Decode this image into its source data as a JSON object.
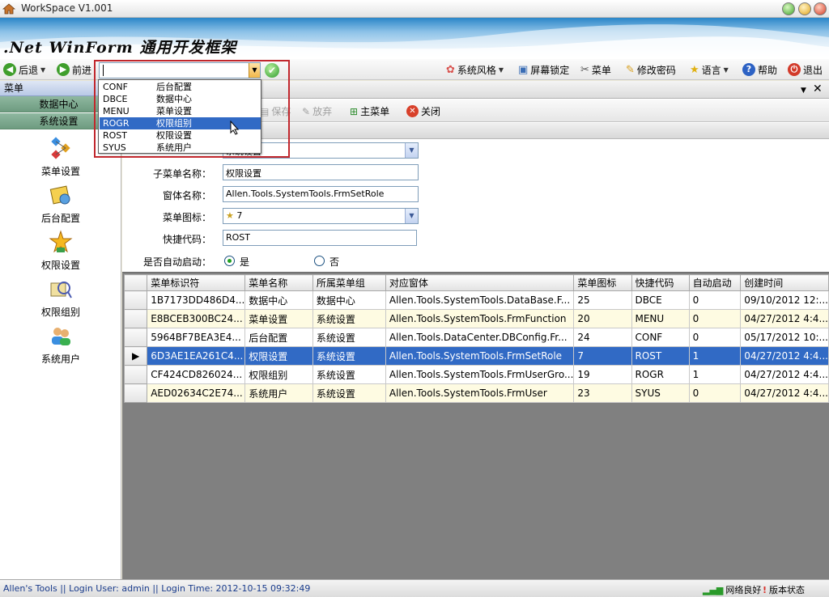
{
  "window": {
    "title": "WorkSpace  V1.001"
  },
  "banner": {
    "title": ".Net WinForm 通用开发框架"
  },
  "toolbar": {
    "back": "后退",
    "forward": "前进",
    "items": [
      "系统风格",
      "屏幕锁定",
      "菜单",
      "修改密码",
      "语言",
      "帮助",
      "退出"
    ]
  },
  "popup": {
    "rows": [
      {
        "code": "CONF",
        "name": "后台配置"
      },
      {
        "code": "DBCE",
        "name": "数据中心"
      },
      {
        "code": "MENU",
        "name": "菜单设置"
      },
      {
        "code": "ROGR",
        "name": "权限组别"
      },
      {
        "code": "ROST",
        "name": "权限设置"
      },
      {
        "code": "SYUS",
        "name": "系统用户"
      }
    ],
    "selected_index": 3
  },
  "leftnav": {
    "header": "菜单",
    "groups": [
      "数据中心",
      "系统设置"
    ],
    "items": [
      "菜单设置",
      "后台配置",
      "权限设置",
      "权限组别",
      "系统用户"
    ]
  },
  "formtoolbar": {
    "save": "保存",
    "discard": "放弃",
    "main_menu": "主菜单",
    "close": "关闭"
  },
  "form": {
    "group_value": "系统设置",
    "submenu_label": "子菜单名称：",
    "submenu_value": "权限设置",
    "window_label": "窗体名称：",
    "window_value": "Allen.Tools.SystemTools.FrmSetRole",
    "icon_label": "菜单图标：",
    "icon_value": "7",
    "shortcut_label": "快捷代码：",
    "shortcut_value": "ROST",
    "autostart_label": "是否自动启动：",
    "yes": "是",
    "no": "否"
  },
  "grid": {
    "columns": [
      "菜单标识符",
      "菜单名称",
      "所属菜单组",
      "对应窗体",
      "菜单图标",
      "快捷代码",
      "自动启动",
      "创建时间"
    ],
    "rows": [
      [
        "1B7173DD486D4...",
        "数据中心",
        "数据中心",
        "Allen.Tools.SystemTools.DataBase.F...",
        "25",
        "DBCE",
        "0",
        "09/10/2012 12:..."
      ],
      [
        "E8BCEB300BC24...",
        "菜单设置",
        "系统设置",
        "Allen.Tools.SystemTools.FrmFunction",
        "20",
        "MENU",
        "0",
        "04/27/2012 4:4..."
      ],
      [
        "5964BF7BEA3E4...",
        "后台配置",
        "系统设置",
        "Allen.Tools.DataCenter.DBConfig.Fr...",
        "24",
        "CONF",
        "0",
        "05/17/2012 10:..."
      ],
      [
        "6D3AE1EA261C4...",
        "权限设置",
        "系统设置",
        "Allen.Tools.SystemTools.FrmSetRole",
        "7",
        "ROST",
        "1",
        "04/27/2012 4:4..."
      ],
      [
        "CF424CD826024...",
        "权限组别",
        "系统设置",
        "Allen.Tools.SystemTools.FrmUserGro...",
        "19",
        "ROGR",
        "1",
        "04/27/2012 4:4..."
      ],
      [
        "AED02634C2E74...",
        "系统用户",
        "系统设置",
        "Allen.Tools.SystemTools.FrmUser",
        "23",
        "SYUS",
        "0",
        "04/27/2012 4:4..."
      ]
    ],
    "selected_index": 3
  },
  "status": {
    "left": "Allen's Tools  ||  Login User: admin  ||  Login Time: 2012-10-15 09:32:49",
    "network": "网络良好",
    "version": "版本状态"
  },
  "colors": {
    "selection": "#316ac5",
    "highlight": "#c1272d",
    "nav_group": "#7ea890"
  }
}
